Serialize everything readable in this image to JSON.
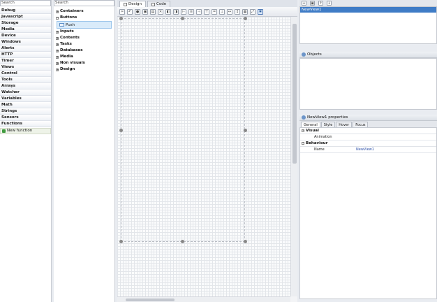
{
  "left_panel": {
    "search_placeholder": "Search",
    "categories": [
      "Debug",
      "Javascript",
      "Storage",
      "Media",
      "Device",
      "Windows",
      "Alerts",
      "HTTP",
      "Timer",
      "Views",
      "Control",
      "Tools",
      "Arrays",
      "Watcher",
      "Variables",
      "Math",
      "Strings",
      "Sensors",
      "Functions"
    ],
    "new_function_label": "New function"
  },
  "components_panel": {
    "search_placeholder": "Search",
    "items": [
      "Containers",
      "Buttons",
      "Inputs",
      "Contents",
      "Tasks",
      "Databases",
      "Media",
      "Non visuals",
      "Design"
    ],
    "selected_sub_item": "Push"
  },
  "designer": {
    "tabs": [
      {
        "label": "Design",
        "active": true
      },
      {
        "label": "Code",
        "active": false
      }
    ]
  },
  "views_panel": {
    "items": [
      "NewView1"
    ]
  },
  "objects_panel": {
    "title": "Objects"
  },
  "properties_panel": {
    "title": "NewView1 properties",
    "tabs": [
      "General",
      "Style",
      "Hover",
      "Focus"
    ],
    "groups": [
      {
        "name": "Visual",
        "rows": [
          {
            "key": "Animation",
            "value": ""
          }
        ]
      },
      {
        "name": "Behaviour",
        "rows": [
          {
            "key": "Name",
            "value": "NewView1"
          }
        ]
      }
    ]
  },
  "colors": {
    "selection": "#3f7cc6",
    "accent": "#6c95c9"
  }
}
